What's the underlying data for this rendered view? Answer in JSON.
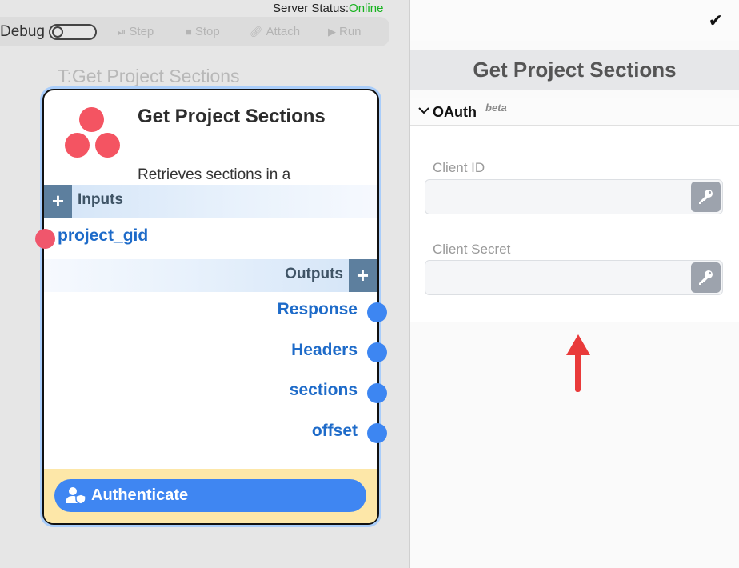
{
  "server_status": {
    "label": "Server Status:",
    "value": "Online",
    "value_color": "#17b31f"
  },
  "toolbar": {
    "debug_label": "Debug",
    "debug_on": false,
    "step": "Step",
    "stop": "Stop",
    "attach": "Attach",
    "run": "Run"
  },
  "node": {
    "canvas_title": "T:Get Project Sections",
    "heading": "Get Project Sections",
    "description": "Retrieves sections in a",
    "logo_color": "#f45462",
    "inputs_label": "Inputs",
    "inputs": [
      {
        "name": "project_gid",
        "port_color": "#f0566c"
      }
    ],
    "outputs_label": "Outputs",
    "outputs": [
      {
        "name": "Response"
      },
      {
        "name": "Headers"
      },
      {
        "name": "sections"
      },
      {
        "name": "offset"
      }
    ],
    "output_port_color": "#3d86f2",
    "auth_button": "Authenticate"
  },
  "panel": {
    "title": "Get Project Sections",
    "section": {
      "label": "OAuth",
      "badge": "beta",
      "expanded": true
    },
    "fields": [
      {
        "label": "Client ID",
        "value": "",
        "icon": "key-icon"
      },
      {
        "label": "Client Secret",
        "value": "",
        "icon": "key-icon"
      }
    ]
  }
}
